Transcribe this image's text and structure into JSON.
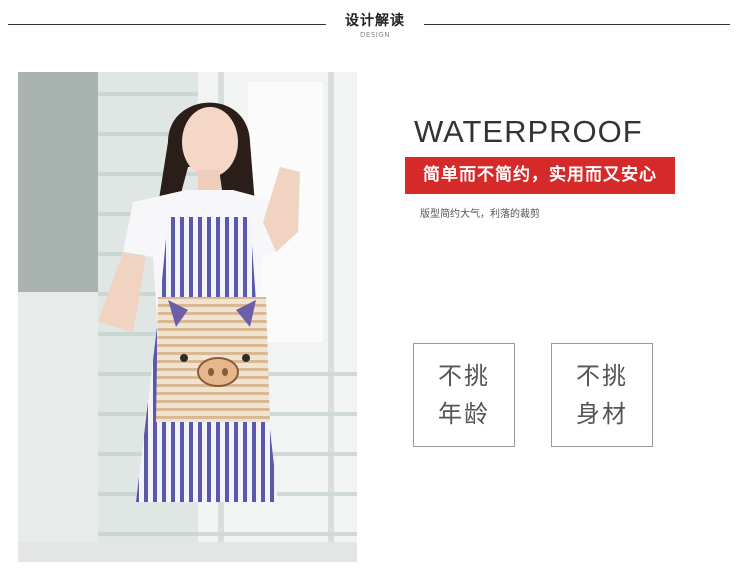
{
  "header": {
    "title": "设计解读",
    "subtitle": "DESIGN"
  },
  "product": {
    "headline": "WATERPROOF",
    "banner": "简单而不简约，实用而又安心",
    "tagline": "版型简约大气，利落的裁剪"
  },
  "features": [
    {
      "line1": "不挑",
      "line2": "年龄"
    },
    {
      "line1": "不挑",
      "line2": "身材"
    }
  ],
  "colors": {
    "banner_red": "#d62a2a",
    "stripe_purple": "#5a58a8",
    "pocket_beige": "#e6cdb0"
  }
}
